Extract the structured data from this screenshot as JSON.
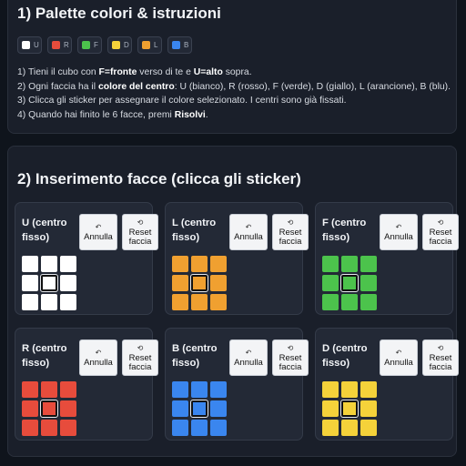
{
  "section1": {
    "title": "1) Palette colori & istruzioni"
  },
  "palette": [
    {
      "letter": "U",
      "color": "#ffffff"
    },
    {
      "letter": "R",
      "color": "#e74c3c"
    },
    {
      "letter": "F",
      "color": "#4cc34c"
    },
    {
      "letter": "D",
      "color": "#f5d23a"
    },
    {
      "letter": "L",
      "color": "#f0a030"
    },
    {
      "letter": "B",
      "color": "#3a86ef"
    }
  ],
  "instructions": {
    "l1a": "1) Tieni il cubo con ",
    "l1b": "F=fronte",
    "l1c": " verso di te e ",
    "l1d": "U=alto",
    "l1e": " sopra.",
    "l2a": "2) Ogni faccia ha il ",
    "l2b": "colore del centro",
    "l2c": ": U (bianco), R (rosso), F (verde), D (giallo), L (arancione), B (blu).",
    "l3": "3) Clicca gli sticker per assegnare il colore selezionato. I centri sono già fissati.",
    "l4a": "4) Quando hai finito le 6 facce, premi ",
    "l4b": "Risolvi",
    "l4c": "."
  },
  "section2": {
    "title": "2) Inserimento facce (clicca gli sticker)"
  },
  "buttons": {
    "annulla_icon": "↶",
    "annulla": "Annulla",
    "reset_icon": "⟲",
    "reset_1": "Reset",
    "reset_2": "faccia"
  },
  "faces": [
    {
      "id": "U",
      "title_1": "U (centro",
      "title_2": "fisso)",
      "color": "#ffffff"
    },
    {
      "id": "L",
      "title_1": "L (centro",
      "title_2": "fisso)",
      "color": "#f0a030"
    },
    {
      "id": "F",
      "title_1": "F (centro",
      "title_2": "fisso)",
      "color": "#4cc34c"
    },
    {
      "id": "R",
      "title_1": "R (centro",
      "title_2": "fisso)",
      "color": "#e74c3c"
    },
    {
      "id": "B",
      "title_1": "B (centro",
      "title_2": "fisso)",
      "color": "#3a86ef"
    },
    {
      "id": "D",
      "title_1": "D (centro",
      "title_2": "fisso)",
      "color": "#f5d23a"
    }
  ]
}
